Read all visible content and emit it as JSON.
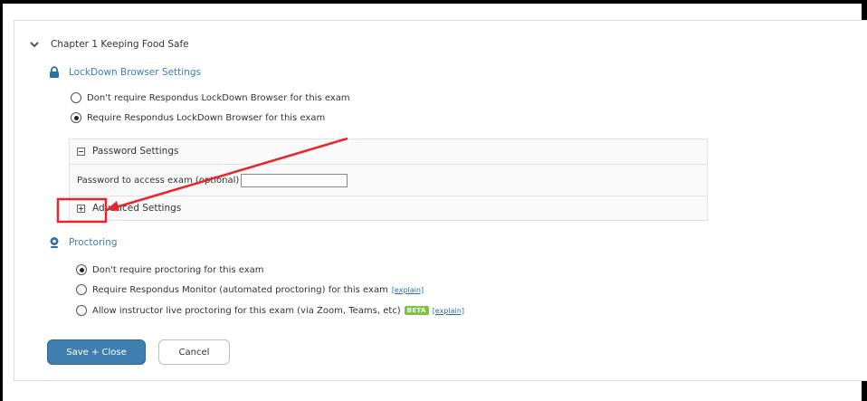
{
  "chapter": {
    "title": "Chapter 1 Keeping Food Safe"
  },
  "lockdown": {
    "title": "LockDown Browser Settings",
    "options": [
      {
        "label": "Don't require Respondus LockDown Browser for this exam",
        "selected": false
      },
      {
        "label": "Require Respondus LockDown Browser for this exam",
        "selected": true
      }
    ],
    "password_settings": {
      "title": "Password Settings",
      "field_label": "Password to access exam (optional)",
      "field_value": ""
    },
    "advanced_settings": {
      "title": "Advanced Settings"
    }
  },
  "proctoring": {
    "title": "Proctoring",
    "options": [
      {
        "label": "Don't require proctoring for this exam",
        "selected": true
      },
      {
        "label": "Require Respondus Monitor (automated proctoring) for this exam",
        "selected": false,
        "link": "[explain]"
      },
      {
        "label": "Allow instructor live proctoring for this exam (via Zoom, Teams, etc)",
        "selected": false,
        "badge": "BETA",
        "link": "[explain]"
      }
    ]
  },
  "buttons": {
    "save": "Save + Close",
    "cancel": "Cancel"
  },
  "colors": {
    "accent": "#3e7fb0",
    "link": "#3a7fb6",
    "annotation": "#e8252b",
    "beta_badge": "#7fc341"
  }
}
